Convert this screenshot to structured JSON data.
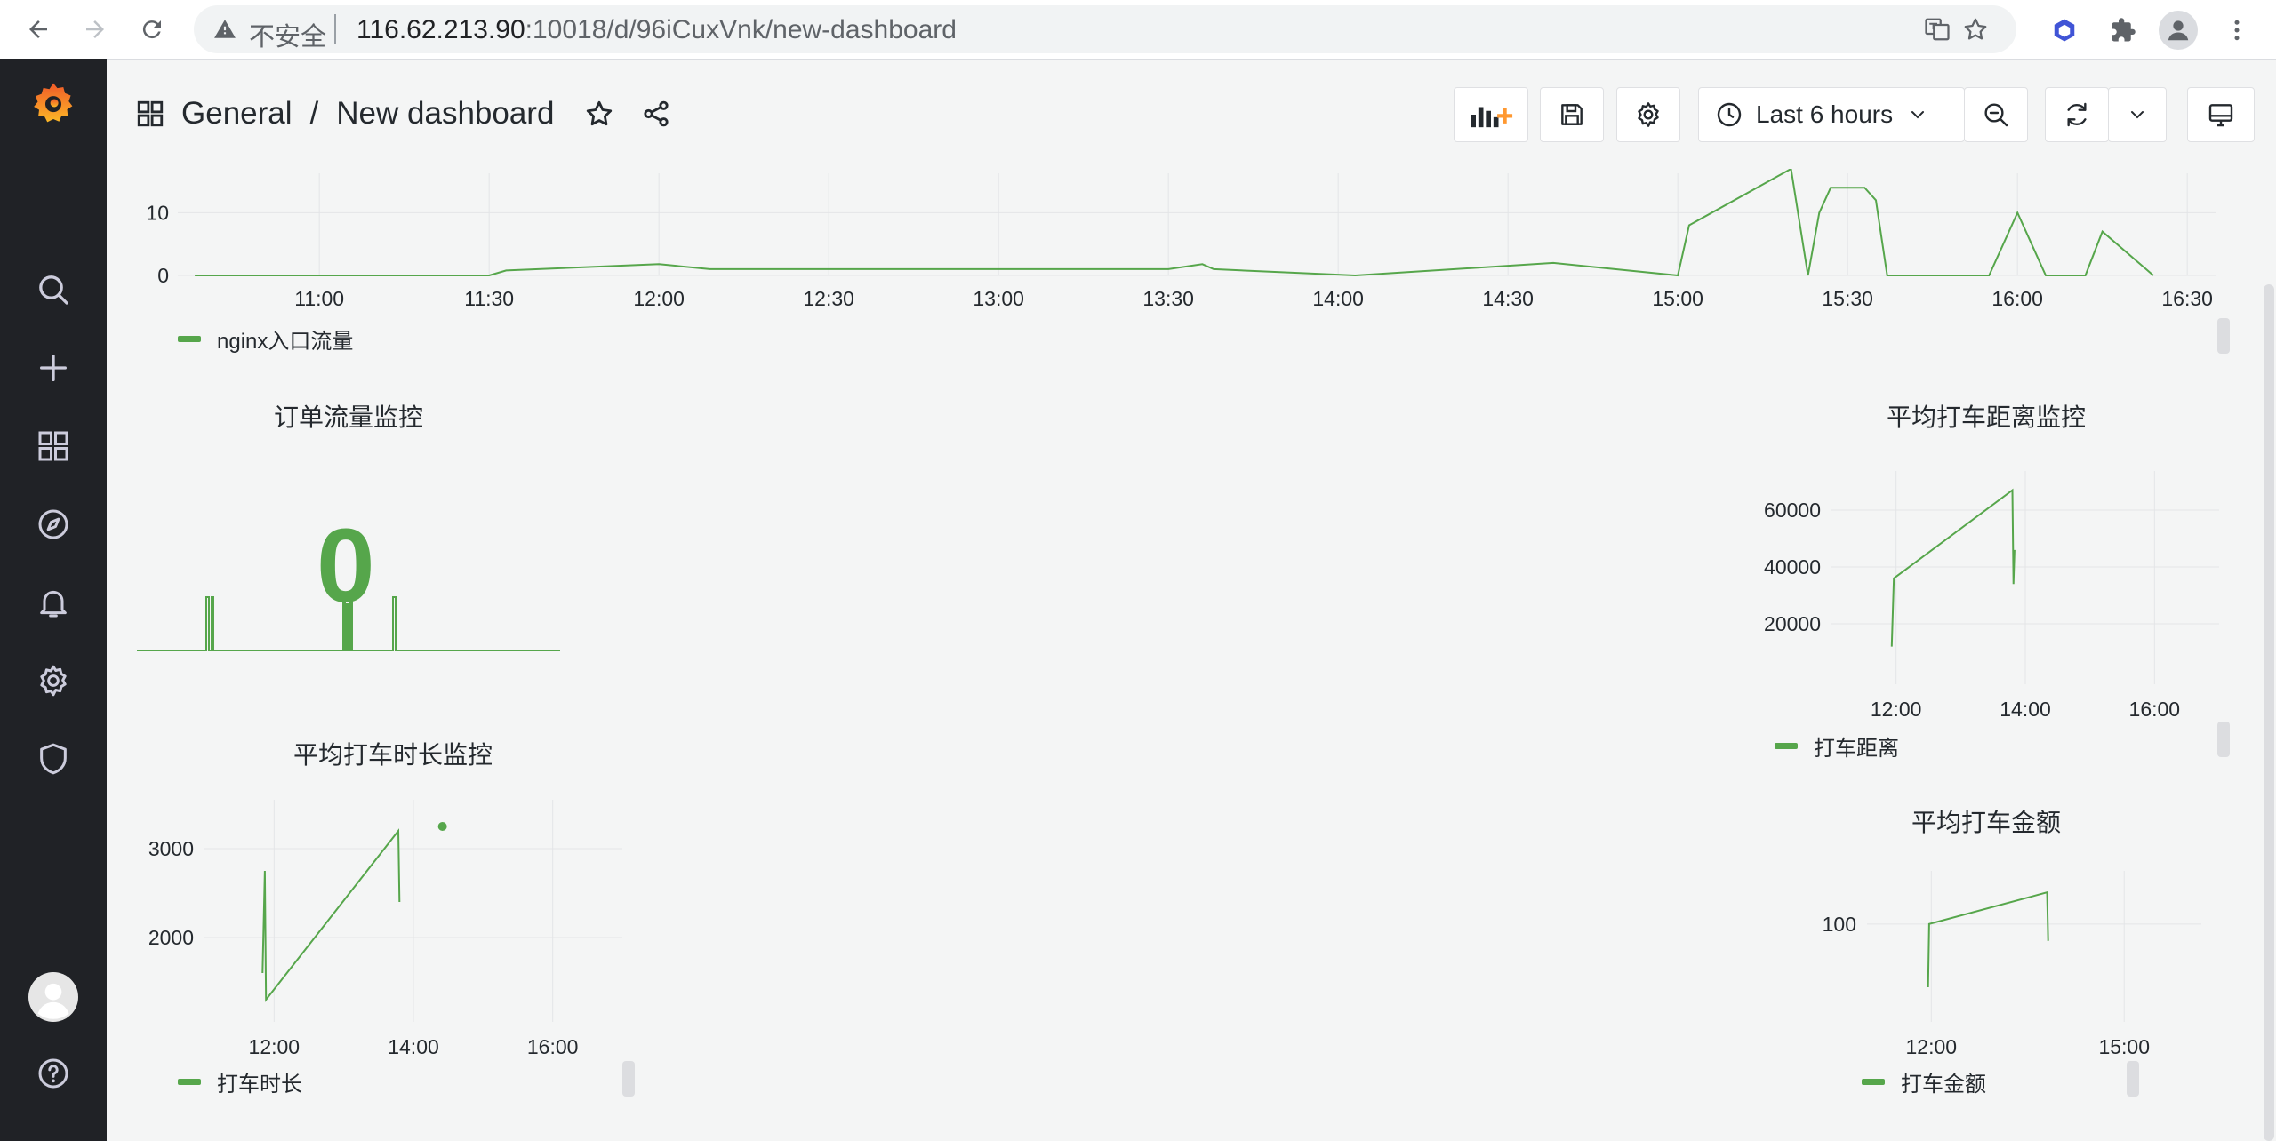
{
  "browser": {
    "security_label": "不安全",
    "url_host": "116.62.213.90",
    "url_rest": ":10018/d/96iCuxVnk/new-dashboard"
  },
  "dashboard": {
    "folder": "General",
    "title": "New dashboard",
    "time_range": "Last 6 hours"
  },
  "colors": {
    "series": "#56a64b",
    "sidebar": "#202226",
    "background": "#f4f5f5"
  },
  "panels": {
    "nginx": {
      "legend": "nginx入口流量",
      "y_ticks": [
        "10",
        "0"
      ],
      "x_ticks": [
        "11:00",
        "11:30",
        "12:00",
        "12:30",
        "13:00",
        "13:30",
        "14:00",
        "14:30",
        "15:00",
        "15:30",
        "16:00",
        "16:30"
      ]
    },
    "orders": {
      "title": "订单流量监控",
      "value": "0"
    },
    "distance": {
      "title": "平均打车距离监控",
      "legend": "打车距离",
      "y_ticks": [
        "60000",
        "40000",
        "20000"
      ],
      "x_ticks": [
        "12:00",
        "14:00",
        "16:00"
      ]
    },
    "duration": {
      "title": "平均打车时长监控",
      "legend": "打车时长",
      "y_ticks": [
        "3000",
        "2000"
      ],
      "x_ticks": [
        "12:00",
        "14:00",
        "16:00"
      ]
    },
    "amount": {
      "title": "平均打车金额",
      "legend": "打车金额",
      "y_ticks": [
        "100"
      ],
      "x_ticks": [
        "12:00",
        "15:00"
      ]
    }
  },
  "chart_data": [
    {
      "type": "line",
      "series": [
        {
          "name": "nginx入口流量"
        }
      ],
      "x": [
        "10:38",
        "10:45",
        "11:00",
        "11:30",
        "11:33",
        "12:00",
        "12:09",
        "12:14",
        "12:25",
        "12:34",
        "12:48",
        "13:30",
        "13:36",
        "13:38",
        "14:03",
        "14:38",
        "15:00",
        "15:02",
        "15:20",
        "15:23",
        "15:25",
        "15:27",
        "15:30",
        "15:33",
        "15:35",
        "15:37",
        "15:45",
        "15:55",
        "16:00",
        "16:05",
        "16:12",
        "16:15",
        "16:24"
      ],
      "y": [
        0,
        0,
        0,
        0,
        0.8,
        1.8,
        1,
        1,
        1,
        1,
        1,
        1,
        1.8,
        1,
        0,
        2,
        0,
        8,
        17,
        0,
        10,
        14,
        14,
        14,
        12,
        0,
        0,
        0,
        10,
        0,
        0,
        7,
        0
      ],
      "y_ticks": [
        "0",
        "10"
      ],
      "x_ticks": [
        "11:00",
        "11:30",
        "12:00",
        "12:30",
        "13:00",
        "13:30",
        "14:00",
        "14:30",
        "15:00",
        "15:30",
        "16:00",
        "16:30"
      ]
    },
    {
      "type": "line",
      "title": "平均打车距离监控",
      "series": [
        {
          "name": "打车距离"
        }
      ],
      "points": [
        [
          "11:56",
          12000
        ],
        [
          "11:58",
          36000
        ],
        [
          "13:48",
          67000
        ],
        [
          "13:49",
          34000
        ],
        [
          "13:50",
          46000
        ]
      ],
      "y_ticks": [
        "20000",
        "40000",
        "60000"
      ],
      "x_ticks": [
        "12:00",
        "14:00",
        "16:00"
      ]
    },
    {
      "type": "line",
      "title": "平均打车时长监控",
      "series": [
        {
          "name": "打车时长"
        }
      ],
      "points": [
        [
          "11:50",
          1600
        ],
        [
          "11:52",
          2750
        ],
        [
          "11:53",
          1300
        ],
        [
          "13:47",
          3200
        ],
        [
          "13:48",
          2400
        ],
        [
          "14:25",
          3250
        ]
      ],
      "y_ticks": [
        "2000",
        "3000"
      ],
      "x_ticks": [
        "12:00",
        "14:00",
        "16:00"
      ]
    },
    {
      "type": "line",
      "title": "平均打车金额",
      "series": [
        {
          "name": "打车金额"
        }
      ],
      "points": [
        [
          "11:57",
          70
        ],
        [
          "11:58",
          100
        ],
        [
          "13:48",
          115
        ],
        [
          "13:49",
          92
        ]
      ],
      "y_ticks": [
        "100"
      ],
      "x_ticks": [
        "12:00",
        "15:00"
      ]
    }
  ]
}
